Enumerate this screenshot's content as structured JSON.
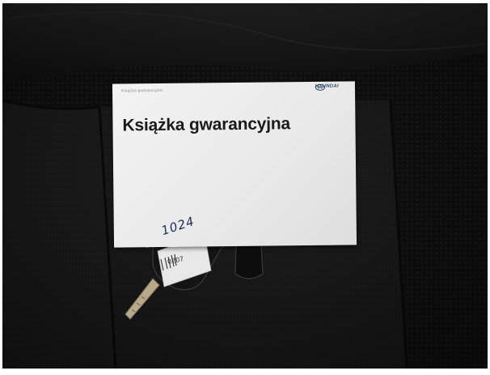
{
  "booklet": {
    "small_text": "Książka gwarancyjna",
    "brand_text": "HYUNDAI",
    "title": "Książka gwarancyjna"
  },
  "key_tag": {
    "handwriting": "1024"
  },
  "key_label": {
    "handwriting": "0207"
  },
  "icons": [
    "hyundai-logo-icon",
    "lock-icon",
    "unlock-icon",
    "trunk-icon"
  ],
  "colors": {
    "seat_fabric": "#1b1b1b",
    "tag_blue": "#2aa3e6",
    "paper": "#efefef",
    "brand_navy": "#34496b"
  }
}
